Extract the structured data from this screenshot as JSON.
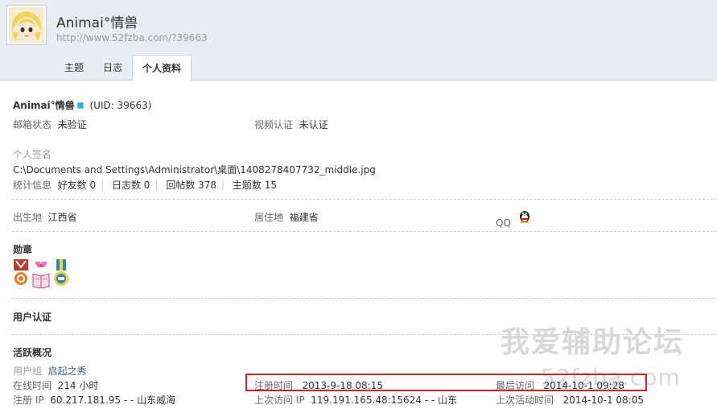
{
  "profile": {
    "name": "Animai°情兽",
    "url": "http://www.52fzba.com/?39663"
  },
  "tabs": [
    {
      "label": "主题"
    },
    {
      "label": "日志"
    },
    {
      "label": "个人资料"
    }
  ],
  "basic": {
    "name": "Animai°情兽",
    "uid": "(UID: 39663)",
    "email_label": "邮箱状态",
    "email_value": "未验证",
    "video_label": "视频认证",
    "video_value": "未认证",
    "signature_label": "个人签名",
    "signature_value": "C:\\Documents and Settings\\Administrator\\桌面\\1408278407732_middle.jpg",
    "stats_label": "统计信息",
    "stats": [
      "好友数 0",
      "日志数 0",
      "回帖数 378",
      "主题数 15"
    ]
  },
  "personal": {
    "birthplace_label": "出生地",
    "birthplace_value": "江西省",
    "residence_label": "居住地",
    "residence_value": "福建省",
    "qq_label": "QQ"
  },
  "sections": {
    "medals_title": "勋章",
    "auth_title": "用户认证",
    "activity_title": "活跃概况"
  },
  "activity": {
    "group_label": "用户组",
    "group_value": "启起之秀",
    "online_label": "在线时间",
    "online_value": "214 小时",
    "reg_time_label": "注册时间",
    "reg_time_value": "2013-9-18 08:15",
    "last_visit_label": "最后访问",
    "last_visit_value": "2014-10-1 09:28",
    "reg_ip_label": "注册 IP",
    "reg_ip_value": "60.217.181.95 - - 山东威海",
    "last_ip_label": "上次访问 IP",
    "last_ip_value": "119.191.165.48:15624 - - 山东",
    "last_active_label": "上次活动时间",
    "last_active_value": "2014-10-1 08:05"
  },
  "watermark": {
    "line1": "我爱辅助论坛",
    "line2": "52fzba.com"
  },
  "colors": {
    "header_bg": "#e8eef3",
    "link": "#336699",
    "highlight": "#d42020"
  }
}
